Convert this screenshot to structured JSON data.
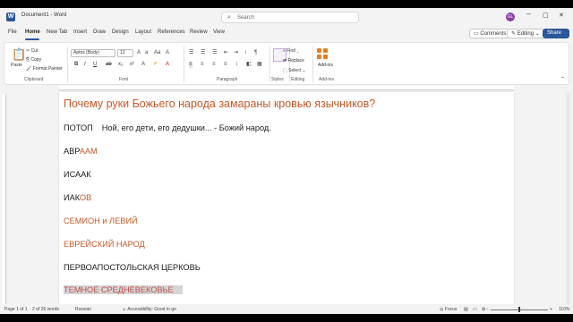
{
  "title_bar": {
    "doc_title": "Document1  -  Word",
    "search_placeholder": "Search",
    "avatar_initials": "GL"
  },
  "tabs": [
    "File",
    "Home",
    "New Tab",
    "Insert",
    "Draw",
    "Design",
    "Layout",
    "References",
    "Review",
    "View"
  ],
  "tab_active": "Home",
  "tab_right": {
    "comments": "Comments",
    "editing": "Editing",
    "share": "Share"
  },
  "ribbon": {
    "clipboard": {
      "paste": "Paste",
      "cut": "Cut",
      "copy": "Copy",
      "format_painter": "Format Painter",
      "label": "Clipboard"
    },
    "font": {
      "font_name": "Aptos (Body)",
      "font_size": "12",
      "label": "Font"
    },
    "paragraph": {
      "label": "Paragraph"
    },
    "styles": {
      "label": "Styles"
    },
    "editing": {
      "find": "Find",
      "replace": "Replace",
      "select": "Select",
      "label": "Editing"
    },
    "addins": {
      "button": "Add-ins",
      "label": "Add-ins"
    }
  },
  "document": {
    "heading": "Почему руки Божьего народа замараны кровью язычников?",
    "lines": [
      {
        "a": "ПОТОП",
        "b": "Ной, его дети, его дедушки... - Божий народ."
      },
      {
        "a": "АВР",
        "b": "ААМ"
      },
      {
        "a": "ИСААК"
      },
      {
        "a": "ИАК",
        "b": "ОВ"
      },
      {
        "a": "СЕМИОН и ЛЕВИЙ"
      },
      {
        "a": "ЕВРЕЙСКИЙ НАРОД"
      },
      {
        "a": "ПЕРВОАПОСТОЛЬСКАЯ ЦЕРКОВЬ"
      },
      {
        "a": "ТЕМНОЕ СРЕДНЕВЕКОВЬЕ"
      }
    ]
  },
  "status_bar": {
    "page": "Page 1 of 1",
    "words": "2 of 26 words",
    "language": "Russian",
    "accessibility": "Accessibility: Good to go",
    "focus": "Focus",
    "zoom": "110%"
  },
  "colors": {
    "accent": "#2b579a",
    "heading": "#c55a28",
    "highlight_text": "#c0504d"
  }
}
